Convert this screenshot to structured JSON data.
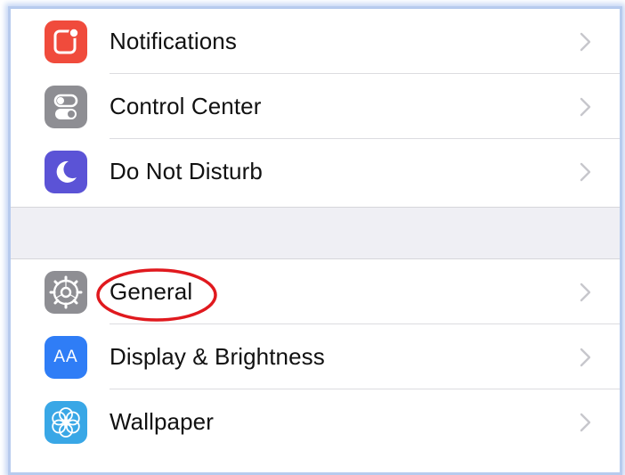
{
  "settings": {
    "group1": [
      {
        "label": "Notifications",
        "icon": "notifications-icon",
        "color": "#f04b3c"
      },
      {
        "label": "Control Center",
        "icon": "control-center-icon",
        "color": "#8e8e93"
      },
      {
        "label": "Do Not Disturb",
        "icon": "moon-icon",
        "color": "#5b53d6"
      }
    ],
    "group2": [
      {
        "label": "General",
        "icon": "gear-icon",
        "color": "#8e8e93"
      },
      {
        "label": "Display & Brightness",
        "icon": "display-icon",
        "color": "#2f7df6",
        "icon_text": "AA"
      },
      {
        "label": "Wallpaper",
        "icon": "wallpaper-icon",
        "color": "#39a7e6"
      }
    ]
  },
  "annotation": {
    "color": "#e0191e",
    "target": "General"
  }
}
